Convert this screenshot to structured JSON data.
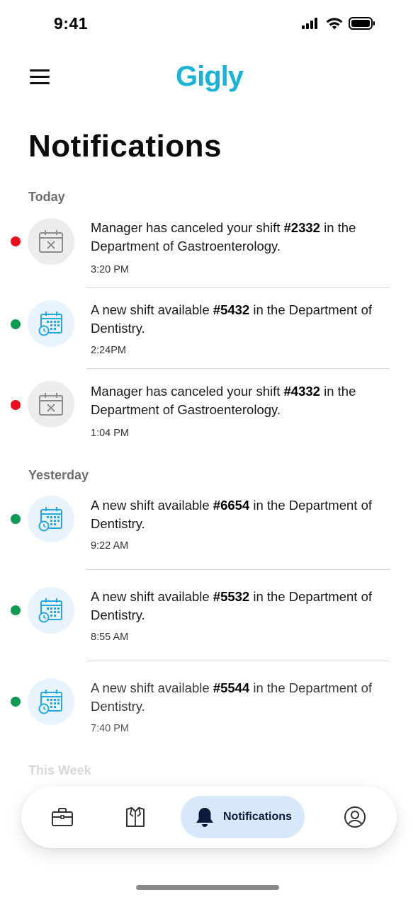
{
  "status_bar": {
    "time": "9:41"
  },
  "header": {
    "logo": "Gigly",
    "menu_icon": "hamburger-menu-icon"
  },
  "page": {
    "title": "Notifications"
  },
  "sections": [
    {
      "label": "Today",
      "items": [
        {
          "status_color": "#e8101e",
          "icon": "calendar-cancel-icon",
          "text_before": "Manager has canceled your shift ",
          "shift_id": "#2332",
          "text_after": " in the Department of Gastroenterology.",
          "time": "3:20 PM"
        },
        {
          "status_color": "#0e9a53",
          "icon": "calendar-clock-icon",
          "text_before": "A new shift available ",
          "shift_id": "#5432",
          "text_after": " in the Department of  Dentistry.",
          "time": "2:24PM"
        },
        {
          "status_color": "#e8101e",
          "icon": "calendar-cancel-icon",
          "text_before": "Manager has canceled your shift ",
          "shift_id": "#4332",
          "text_after": " in the Department of Gastroenterology.",
          "time": "1:04 PM"
        }
      ]
    },
    {
      "label": "Yesterday",
      "items": [
        {
          "status_color": "#0e9a53",
          "icon": "calendar-clock-icon",
          "text_before": "A new shift available ",
          "shift_id": "#6654",
          "text_after": " in the Department of  Dentistry.",
          "time": "9:22 AM"
        },
        {
          "status_color": "#0e9a53",
          "icon": "calendar-clock-icon",
          "text_before": "A new shift available ",
          "shift_id": "#5532",
          "text_after": " in the Department of  Dentistry.",
          "time": "8:55 AM"
        },
        {
          "status_color": "#0e9a53",
          "icon": "calendar-clock-icon",
          "text_before": "A new shift available ",
          "shift_id": "#5544",
          "text_after": " in the Department of  Dentistry.",
          "time": "7:40 PM"
        }
      ]
    },
    {
      "label": "This Week",
      "items": []
    }
  ],
  "bottom_nav": {
    "items": [
      {
        "icon": "briefcase-icon"
      },
      {
        "icon": "uniform-icon"
      },
      {
        "icon": "bell-icon",
        "label": "Notifications",
        "active": true
      },
      {
        "icon": "profile-icon"
      }
    ]
  },
  "colors": {
    "brand": "#1ab3d6",
    "active_tab_bg": "#d8e8fb",
    "unread_cancel": "#e8101e",
    "unread_new": "#0e9a53"
  }
}
